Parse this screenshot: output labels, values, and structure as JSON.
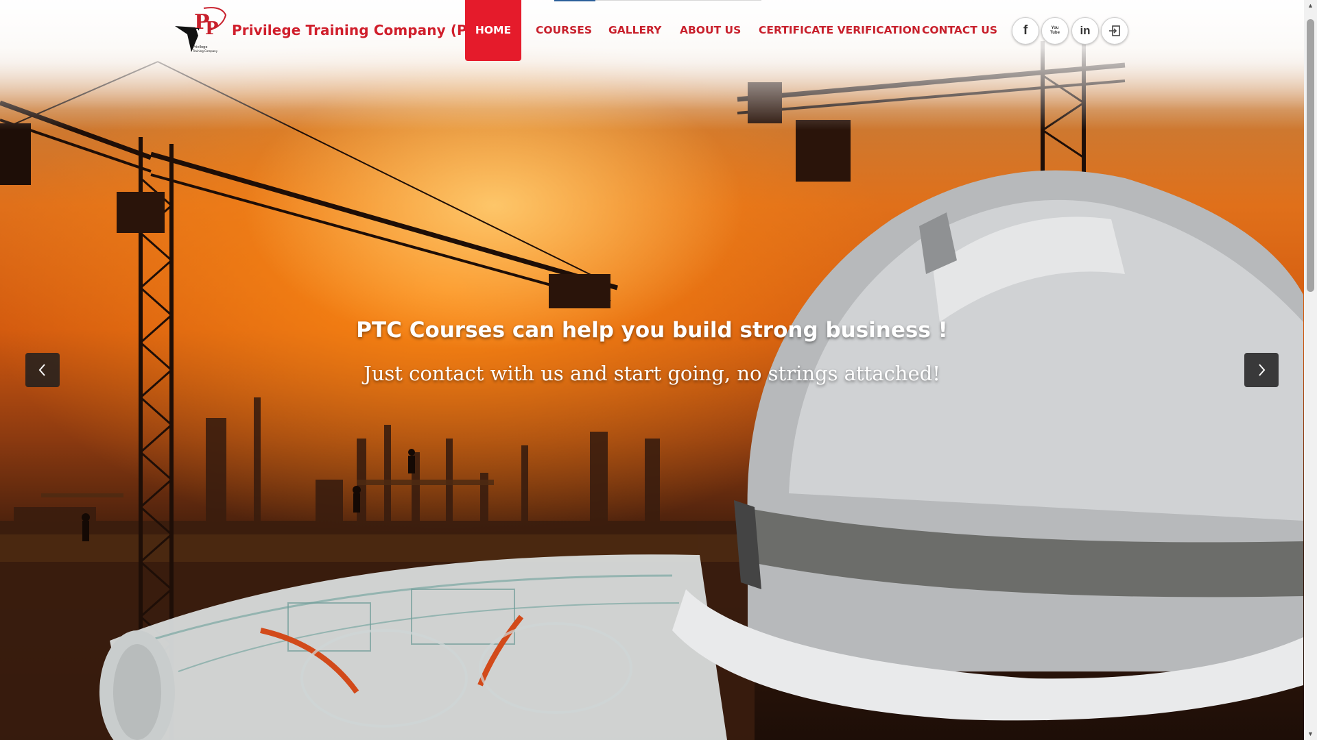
{
  "brand": {
    "name": "Privilege Training Company (PTC)",
    "logo_letters": "PTC"
  },
  "nav": {
    "items": [
      {
        "label": "HOME",
        "active": true
      },
      {
        "label": "COURSES",
        "active": false
      },
      {
        "label": "GALLERY",
        "active": false
      },
      {
        "label": "ABOUT US",
        "active": false
      },
      {
        "label": "CERTIFICATE VERIFICATION",
        "active": false
      },
      {
        "label": "CONTACT US",
        "active": false
      }
    ]
  },
  "social": {
    "facebook": "f",
    "youtube": "You Tube",
    "linkedin": "in",
    "login": "login-icon"
  },
  "hero": {
    "headline": "PTC Courses can help you build strong business !",
    "subline": "Just contact with us and start going, no strings attached!"
  },
  "icons": {
    "prev": "chevron-left-icon",
    "next": "chevron-right-icon"
  },
  "colors": {
    "brand_red": "#d01e2b",
    "active_bg": "#e51b2b",
    "sky_orange": "#e0701a"
  }
}
